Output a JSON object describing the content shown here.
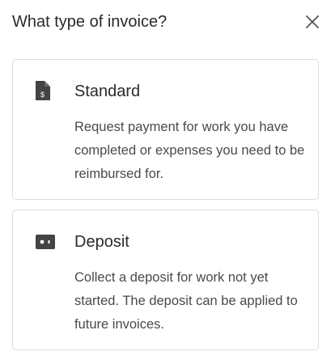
{
  "dialog": {
    "title": "What type of invoice?",
    "close_icon": "close-icon"
  },
  "options": [
    {
      "icon": "dollar-document-icon",
      "title": "Standard",
      "description": "Request payment for work you have completed or expenses you need to be reimbursed for."
    },
    {
      "icon": "deposit-card-icon",
      "title": "Deposit",
      "description": "Collect a deposit for work not yet started. The deposit can be applied to future invoices."
    }
  ],
  "colors": {
    "icon_fill": "#444444",
    "border": "#dcdcdc",
    "text_primary": "#2a2a2a",
    "text_secondary": "#4a4a4a"
  }
}
